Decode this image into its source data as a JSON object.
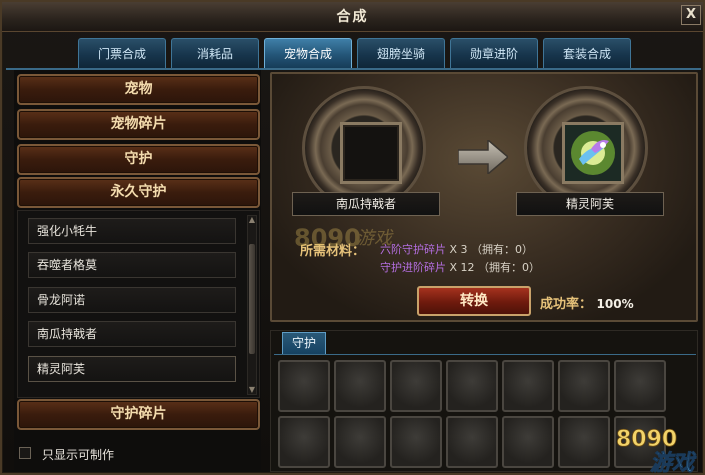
{
  "window": {
    "title": "合成",
    "close_glyph": "X"
  },
  "tabs": [
    {
      "label": "门票合成"
    },
    {
      "label": "消耗品"
    },
    {
      "label": "宠物合成",
      "active": true
    },
    {
      "label": "翅膀坐骑"
    },
    {
      "label": "勋章进阶"
    },
    {
      "label": "套装合成"
    }
  ],
  "sidebar": {
    "categories": [
      "宠物",
      "宠物碎片",
      "守护",
      "永久守护",
      "守护碎片"
    ],
    "items": [
      "强化小牦牛",
      "吞噬者格莫",
      "骨龙阿诺",
      "南瓜持戟者",
      "精灵阿芙"
    ],
    "selected_item": "精灵阿芙",
    "only_craftable_label": "只显示可制作",
    "only_craftable_checked": false
  },
  "craft": {
    "source_name": "南瓜持戟者",
    "target_name": "精灵阿芙",
    "materials_label": "所需材料：",
    "materials": [
      {
        "name": "六阶守护碎片",
        "qty": "X 3",
        "owned": "（拥有：0）"
      },
      {
        "name": "守护进阶碎片",
        "qty": "X 12",
        "owned": "（拥有：0）"
      }
    ],
    "convert_label": "转换",
    "success_rate_label": "成功率：",
    "success_rate_value": "100%"
  },
  "inventory": {
    "tab_label": "守护"
  },
  "watermark": {
    "text": "8090",
    "text2": "游戏"
  },
  "colors": {
    "accent_tab": "#245577",
    "category_button": "#3a1c0d",
    "gold_text": "#e6c27a",
    "material_purple": "#b46ee0"
  }
}
